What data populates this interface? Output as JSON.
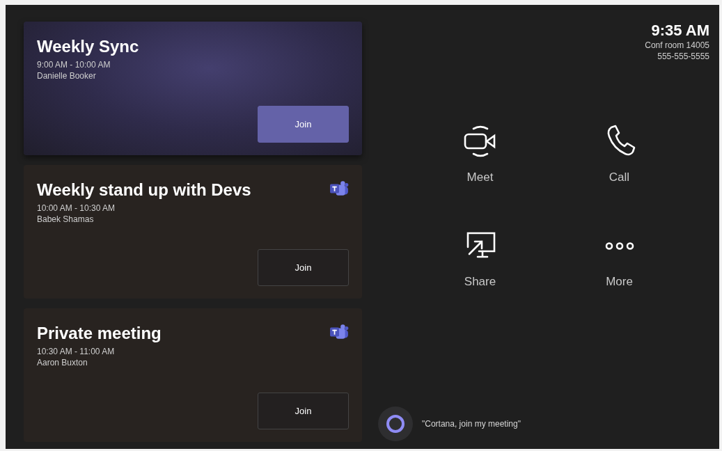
{
  "meetings": [
    {
      "title": "Weekly Sync",
      "time": "9:00 AM - 10:00 AM",
      "organizer": "Danielle Booker",
      "selected": true,
      "app_icon": false,
      "button": "Join"
    },
    {
      "title": "Weekly stand up with Devs",
      "time": "10:00 AM - 10:30 AM",
      "organizer": "Babek Shamas",
      "selected": false,
      "app_icon": true,
      "button": "Join"
    },
    {
      "title": "Private meeting",
      "time": "10:30 AM - 11:00 AM",
      "organizer": "Aaron Buxton",
      "selected": false,
      "app_icon": true,
      "button": "Join"
    }
  ],
  "header": {
    "time": "9:35 AM",
    "room": "Conf room 14005",
    "phone": "555-555-5555"
  },
  "actions": [
    {
      "kind": "video",
      "label": "Meet"
    },
    {
      "kind": "phone",
      "label": "Call"
    },
    {
      "kind": "share",
      "label": "Share"
    },
    {
      "kind": "more",
      "label": "More"
    }
  ],
  "assistant": {
    "prompt": "\"Cortana, join my meeting\""
  }
}
